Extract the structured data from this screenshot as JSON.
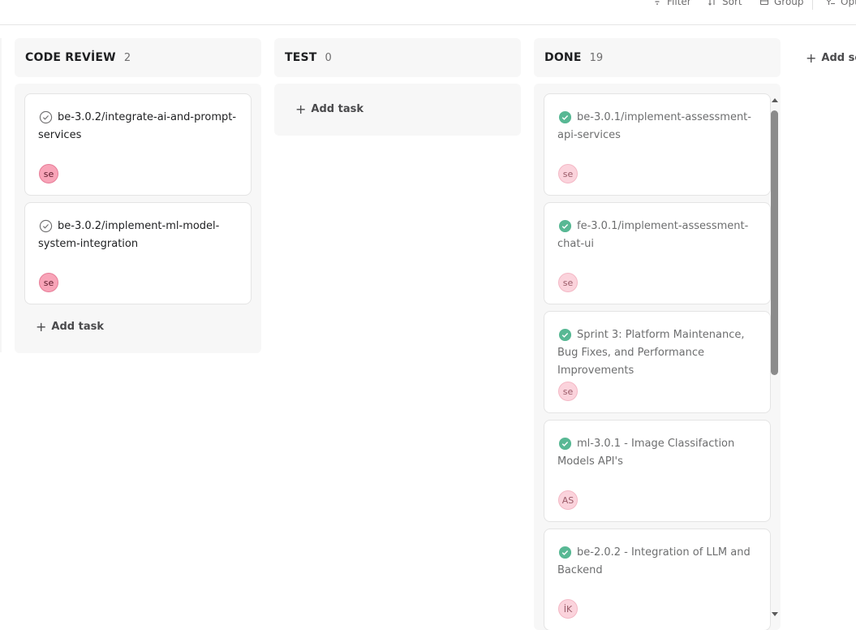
{
  "toolbar": {
    "filter_label": "Filter",
    "sort_label": "Sort",
    "group_label": "Group",
    "options_label": "Options"
  },
  "columns": [
    {
      "title": "CODE REVİEW",
      "count": "2",
      "add_task_label": "Add task",
      "cards": [
        {
          "title": "be-3.0.2/integrate-ai-and-prompt-services",
          "avatar": "se",
          "complete": false
        },
        {
          "title": "be-3.0.2/implement-ml-model-system-integration",
          "avatar": "se",
          "complete": false
        }
      ]
    },
    {
      "title": "TEST",
      "count": "0",
      "add_task_label": "Add task",
      "cards": []
    },
    {
      "title": "DONE",
      "count": "19",
      "cards": [
        {
          "title": "be-3.0.1/implement-assessment-api-services",
          "avatar": "se",
          "complete": true
        },
        {
          "title": "fe-3.0.1/implement-assessment-chat-ui",
          "avatar": "se",
          "complete": true
        },
        {
          "title": "Sprint 3: Platform Maintenance, Bug Fixes, and Performance Improvements",
          "avatar": "se",
          "complete": true
        },
        {
          "title": "ml-3.0.1 - Image Classifaction Models API's",
          "avatar": "AS",
          "complete": true
        },
        {
          "title": "be-2.0.2 - Integration of LLM and Backend",
          "avatar": "İK",
          "complete": true
        }
      ]
    }
  ],
  "add_section_label": "Add section",
  "colors": {
    "done_check": "#58b894",
    "avatar_pink": "#f8a4b8",
    "avatar_light": "#fbd3dc"
  }
}
